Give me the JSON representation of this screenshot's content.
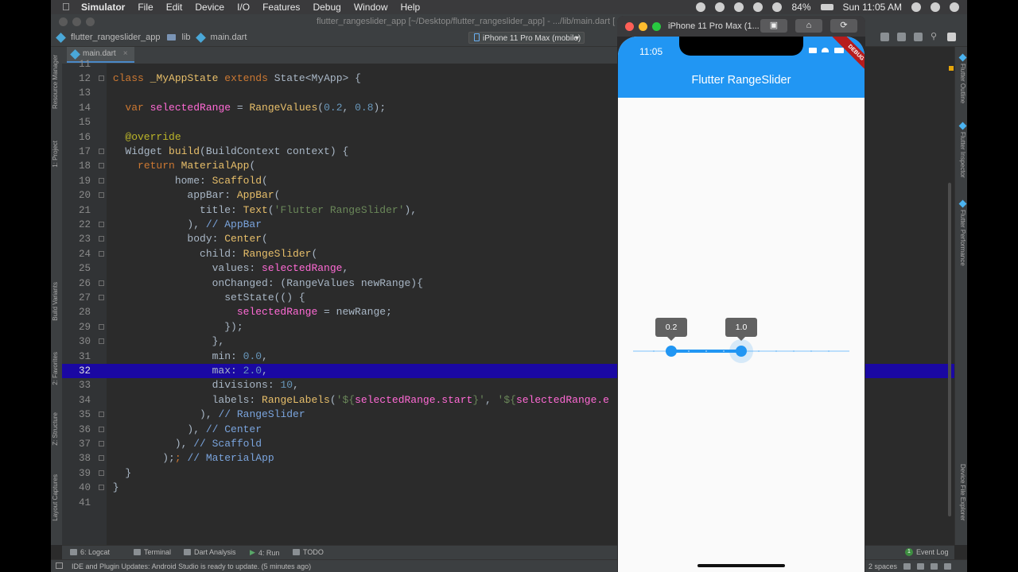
{
  "menubar": {
    "items": [
      "Simulator",
      "File",
      "Edit",
      "Device",
      "I/O",
      "Features",
      "Debug",
      "Window",
      "Help"
    ],
    "battery": "84%",
    "clock": "Sun 11:05 AM"
  },
  "ide": {
    "title": "flutter_rangeslider_app [~/Desktop/flutter_rangeslider_app] - .../lib/main.dart [",
    "breadcrumb": [
      "flutter_rangeslider_app",
      "lib",
      "main.dart"
    ],
    "device_selector": "iPhone 11 Pro Max (mobile)",
    "tab": "main.dart",
    "left_tools": [
      "Resource Manager",
      "1: Project",
      "Build Variants",
      "2: Favorites",
      "Z: Structure",
      "Layout Captures"
    ],
    "right_tools": [
      "Flutter Outline",
      "Flutter Inspector",
      "Flutter Performance",
      "Device File Explorer"
    ],
    "bottom_tools": [
      "6: Logcat",
      "Terminal",
      "Dart Analysis",
      "4: Run",
      "TODO"
    ],
    "event_log": "Event Log",
    "event_log_count": "1",
    "status_message": "IDE and Plugin Updates: Android Studio is ready to update. (5 minutes ago)",
    "indent": "2 spaces",
    "line_numbers": [
      "11",
      "12",
      "13",
      "14",
      "15",
      "16",
      "17",
      "18",
      "19",
      "20",
      "21",
      "22",
      "23",
      "24",
      "25",
      "26",
      "27",
      "28",
      "29",
      "30",
      "31",
      "32",
      "33",
      "34",
      "35",
      "36",
      "37",
      "38",
      "39",
      "40",
      "41"
    ],
    "current_line": "32"
  },
  "simulator": {
    "window_title": "iPhone 11 Pro Max (1...",
    "status_time": "11:05",
    "app_title": "Flutter RangeSlider",
    "debug_banner": "DEBUG",
    "range_start_label": "0.2",
    "range_end_label": "1.0",
    "slider_min": 0.0,
    "slider_max": 2.0,
    "range_start": 0.2,
    "range_end": 1.0,
    "divisions": 10
  },
  "colors": {
    "accent": "#2196f3",
    "editor_bg": "#2b2b2b",
    "current_line_bg": "#1a08a3"
  }
}
